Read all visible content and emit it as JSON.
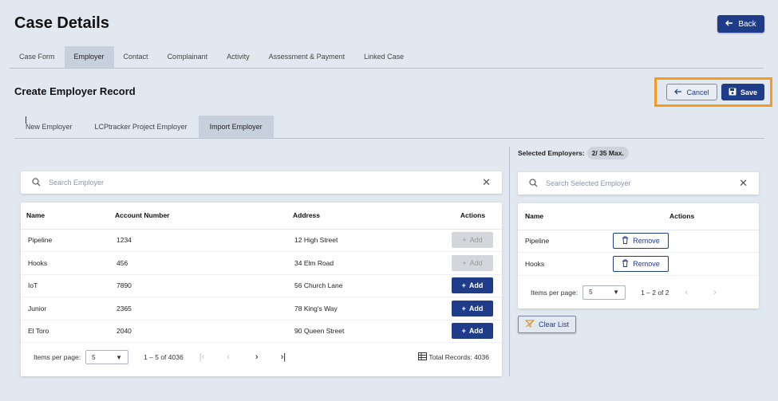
{
  "header": {
    "title": "Case Details",
    "back_label": "Back"
  },
  "tabs": [
    {
      "label": "Case Form"
    },
    {
      "label": "Employer"
    },
    {
      "label": "Contact"
    },
    {
      "label": "Complainant"
    },
    {
      "label": "Activity"
    },
    {
      "label": "Assessment & Payment"
    },
    {
      "label": "Linked Case"
    }
  ],
  "section": {
    "title": "Create Employer Record",
    "cancel_label": "Cancel",
    "save_label": "Save"
  },
  "subtabs": [
    {
      "label": "New Employer"
    },
    {
      "label": "LCPtracker Project Employer"
    },
    {
      "label": "Import Employer"
    }
  ],
  "search": {
    "placeholder": "Search Employer"
  },
  "employers_table": {
    "headers": {
      "name": "Name",
      "account": "Account Number",
      "address": "Address",
      "actions": "Actions"
    },
    "rows": [
      {
        "name": "Pipeline",
        "account": "1234",
        "address": "12 High Street",
        "action": "Add"
      },
      {
        "name": "Hooks",
        "account": "456",
        "address": "34 Elm Road",
        "action": "Add"
      },
      {
        "name": "IoT",
        "account": "7890",
        "address": "56 Church Lane",
        "action": "Add"
      },
      {
        "name": "Junior",
        "account": "2365",
        "address": "78 King's Way",
        "action": "Add"
      },
      {
        "name": "El Toro",
        "account": "2040",
        "address": "90 Queen Street",
        "action": "Add"
      }
    ],
    "paginator": {
      "items_label": "Items per page:",
      "page_size": "5",
      "range": "1 – 5 of 4036",
      "total": "Total Records: 4036"
    }
  },
  "selected": {
    "label": "Selected Employers:",
    "badge": "2/ 35 Max.",
    "search_placeholder": "Search Selected Employer",
    "headers": {
      "name": "Name",
      "actions": "Actions"
    },
    "rows": [
      {
        "name": "Pipeline",
        "action": "Remove"
      },
      {
        "name": "Hooks",
        "action": "Remove"
      }
    ],
    "paginator": {
      "items_label": "Items per page:",
      "page_size": "5",
      "range": "1 – 2 of 2"
    },
    "clear_label": "Clear List"
  },
  "colors": {
    "primary": "#1f3c88",
    "highlight": "#f39c21",
    "background": "#e2e8f0"
  }
}
